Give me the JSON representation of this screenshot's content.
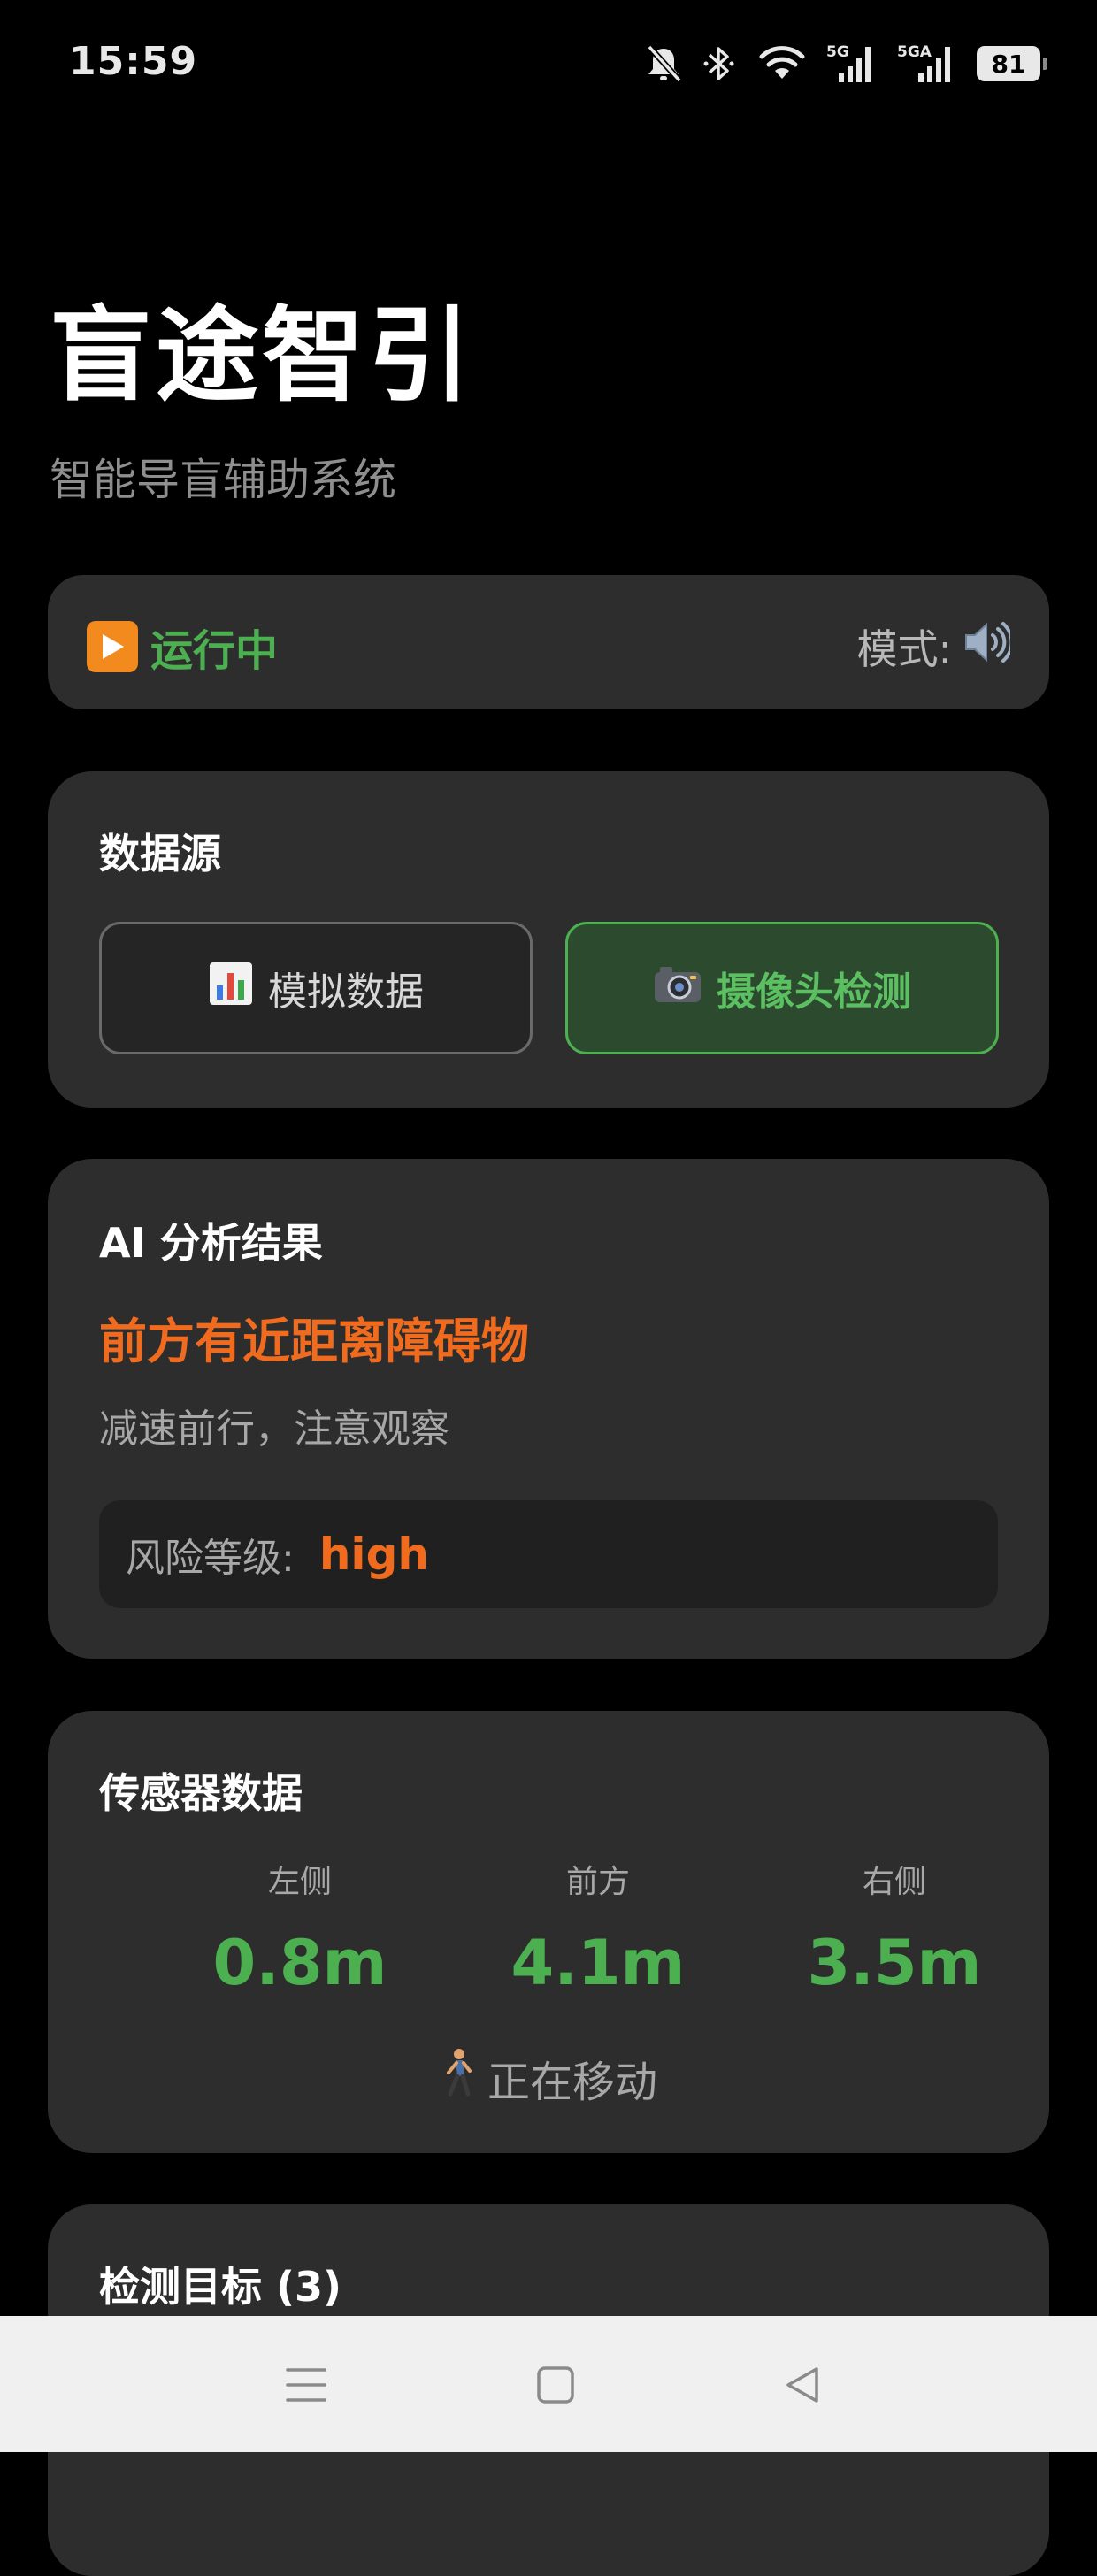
{
  "status_bar": {
    "time": "15:59",
    "signal_1_label": "5G",
    "signal_2_label": "5GA",
    "battery": "81",
    "icons": [
      "bell-muted-icon",
      "bluetooth-icon",
      "wifi-icon",
      "cellular-signal-icon",
      "cellular-signal-icon",
      "battery-icon"
    ]
  },
  "header": {
    "title": "盲途智引",
    "subtitle": "智能导盲辅助系统"
  },
  "run_status": {
    "label": "运行中",
    "icon": "play-icon",
    "mode_label": "模式:",
    "mode_icon": "speaker-icon"
  },
  "data_source": {
    "title": "数据源",
    "simulated_icon": "bar-chart-icon",
    "simulated_label": "模拟数据",
    "camera_icon": "camera-icon",
    "camera_label": "摄像头检测",
    "selected": "camera"
  },
  "ai_analysis": {
    "title": "AI 分析结果",
    "headline": "前方有近距离障碍物",
    "advice": "减速前行，注意观察",
    "risk_label": "风险等级:",
    "risk_value": "high"
  },
  "sensors": {
    "title": "传感器数据",
    "left_label": "左侧",
    "left_value": "0.8m",
    "front_label": "前方",
    "front_value": "4.1m",
    "right_label": "右侧",
    "right_value": "3.5m",
    "motion_icon": "walking-person-icon",
    "motion_text": "正在移动"
  },
  "detection": {
    "title": "检测目标 (3)"
  },
  "colors": {
    "accent_green": "#4caf50",
    "warning_orange": "#f06b1e",
    "card_bg": "#2d2d2d"
  }
}
